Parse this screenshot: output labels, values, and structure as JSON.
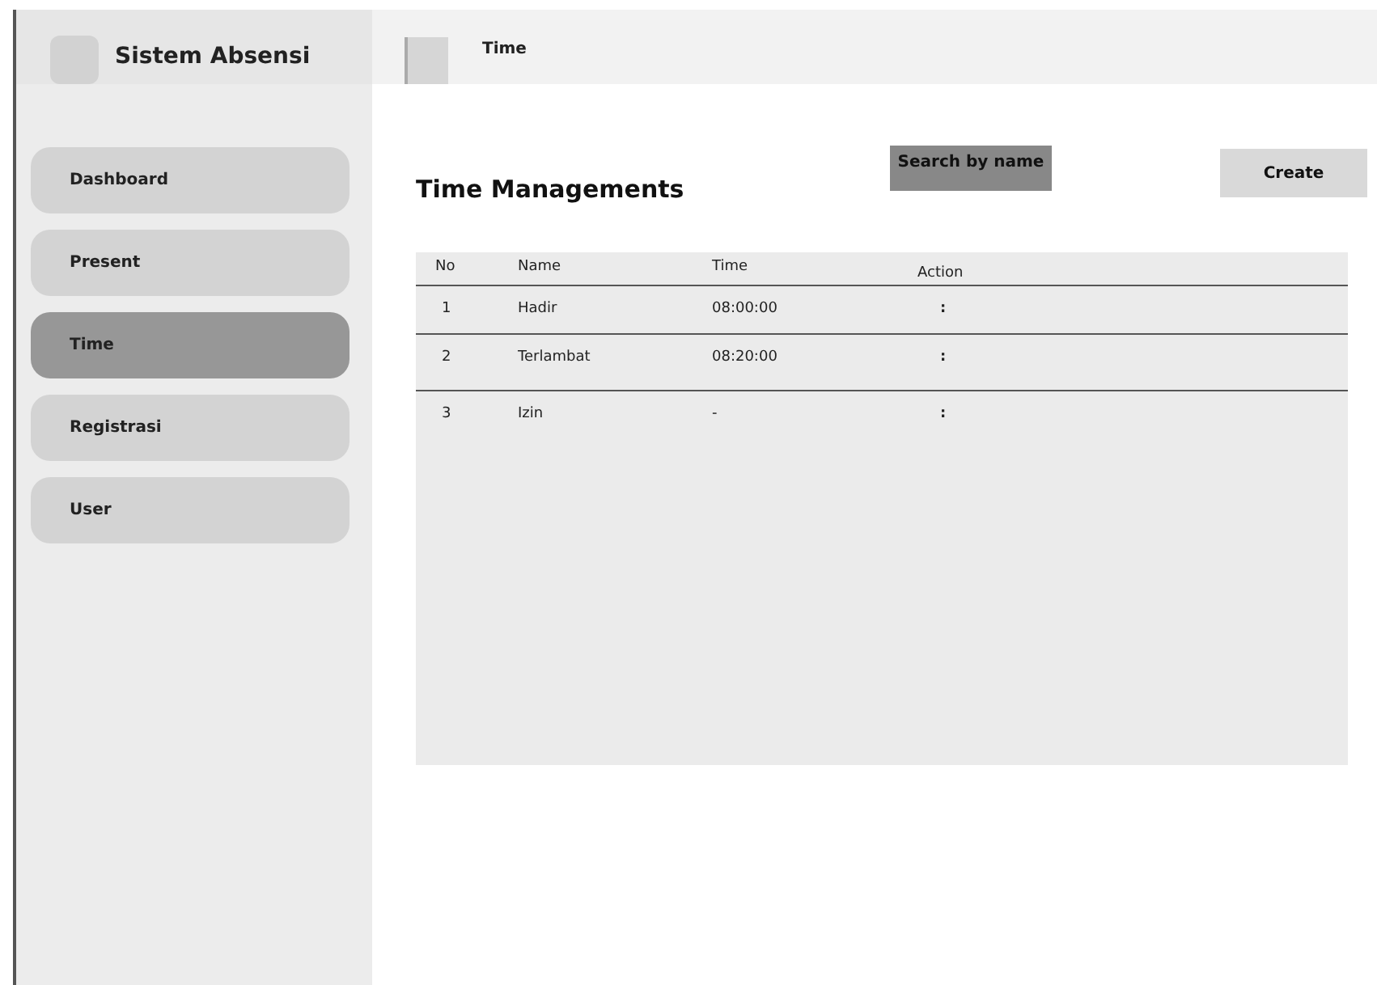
{
  "app": {
    "title": "Sistem Absensi"
  },
  "sidebar": {
    "items": [
      {
        "label": "Dashboard",
        "selected": false
      },
      {
        "label": "Present",
        "selected": false
      },
      {
        "label": "Time",
        "selected": true
      },
      {
        "label": "Registrasi",
        "selected": false
      },
      {
        "label": "User",
        "selected": false
      }
    ]
  },
  "header": {
    "title": "Time"
  },
  "page": {
    "title": "Time Managements",
    "search_button": "Search by name",
    "create_button": "Create"
  },
  "table": {
    "columns": [
      "No",
      "Name",
      "Time",
      "Action"
    ],
    "rows": [
      [
        "1",
        "Hadir",
        "08:00:00",
        ":"
      ],
      [
        "2",
        "Terlambat",
        "08:20:00",
        ":"
      ],
      [
        "3",
        "Izin",
        "-",
        ":"
      ]
    ]
  }
}
